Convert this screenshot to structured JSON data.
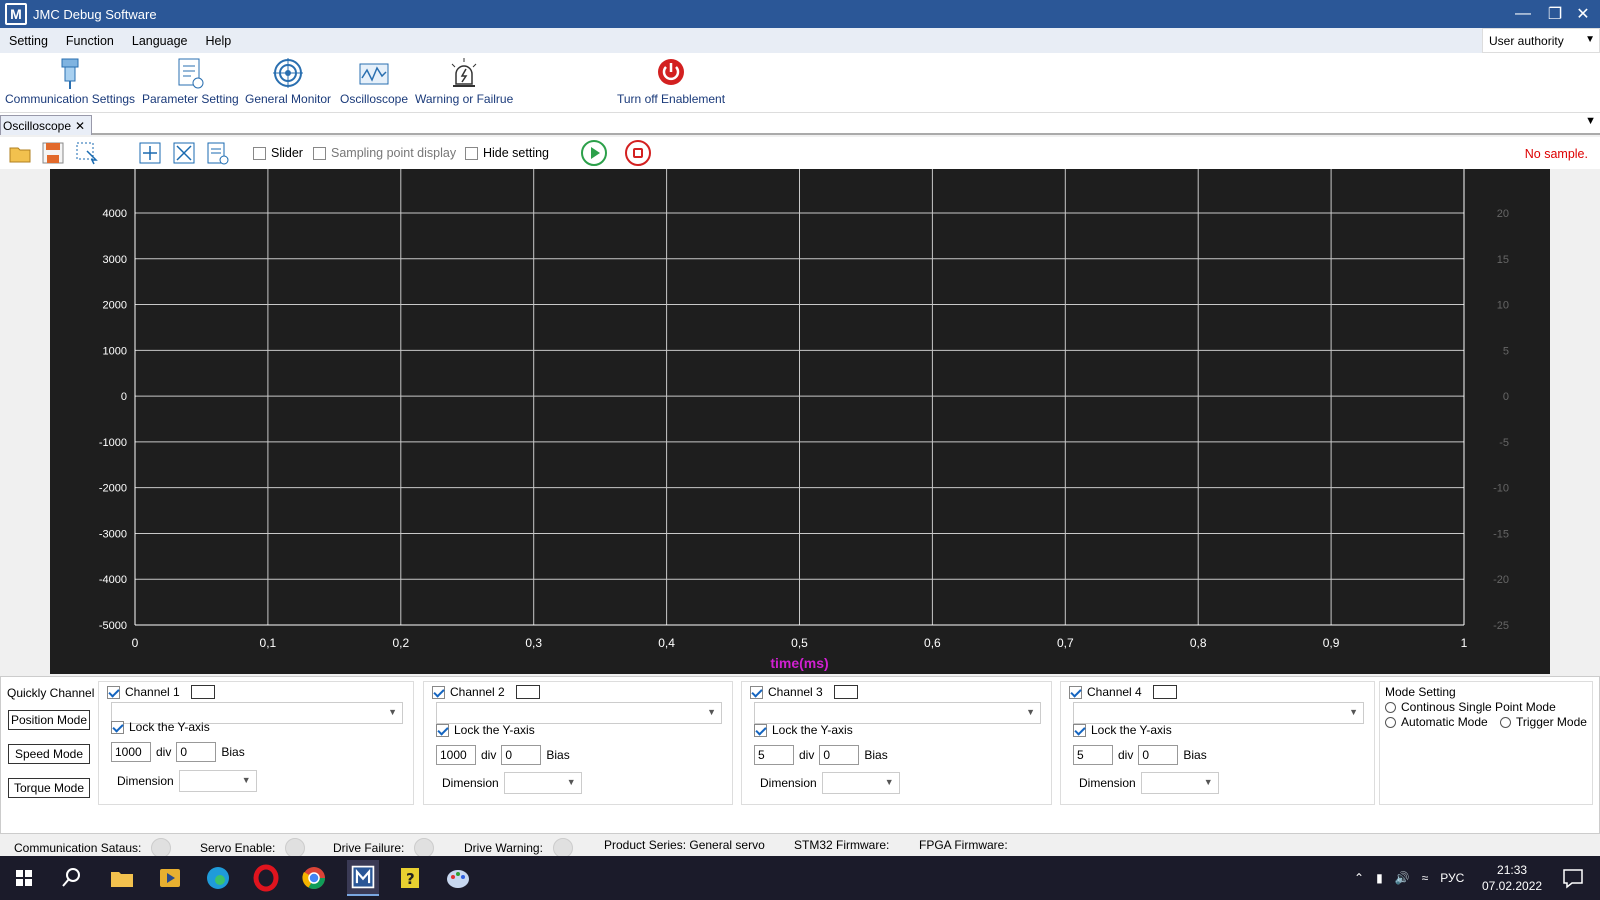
{
  "window": {
    "title": "JMC Debug Software",
    "logo_letter": "M"
  },
  "menu": {
    "items": [
      "Setting",
      "Function",
      "Language",
      "Help"
    ],
    "authority": "User authority"
  },
  "ribbon": {
    "comm": "Communication Settings",
    "param": "Parameter Setting",
    "monitor": "General Monitor",
    "osc": "Oscilloscope",
    "warn": "Warning or Failrue",
    "off": "Turn off Enablement"
  },
  "tab": {
    "label": "Oscilloscope"
  },
  "toolbar": {
    "slider": "Slider",
    "sampling": "Sampling point display",
    "hide": "Hide setting",
    "status": "No sample."
  },
  "chart_data": {
    "type": "line",
    "xlabel": "time(ms)",
    "xlim": [
      0,
      1
    ],
    "x_ticks": [
      "0",
      "0,1",
      "0,2",
      "0,3",
      "0,4",
      "0,5",
      "0,6",
      "0,7",
      "0,8",
      "0,9",
      "1"
    ],
    "y_left_ticks": [
      "4000",
      "3000",
      "2000",
      "1000",
      "0",
      "-1000",
      "-2000",
      "-3000",
      "-4000",
      "-5000"
    ],
    "y_right_ticks": [
      "20",
      "15",
      "10",
      "5",
      "0",
      "-5",
      "-10",
      "-15",
      "-20",
      "-25"
    ],
    "ylim_left": [
      -5000,
      5000
    ],
    "ylim_right": [
      -25,
      25
    ],
    "grid": true,
    "series": [],
    "colors": {
      "background": "#1e1e1e",
      "grid": "#c8c8c8",
      "xlabel": "#d020d0"
    }
  },
  "quick": {
    "label": "Quickly Channel",
    "position": "Position Mode",
    "speed": "Speed Mode",
    "torque": "Torque Mode"
  },
  "channels": [
    {
      "name": "Channel 1",
      "lock": "Lock the Y-axis",
      "div_value": "1000",
      "div": "div",
      "bias_value": "0",
      "bias": "Bias",
      "dimension": "Dimension"
    },
    {
      "name": "Channel 2",
      "lock": "Lock the Y-axis",
      "div_value": "1000",
      "div": "div",
      "bias_value": "0",
      "bias": "Bias",
      "dimension": "Dimension"
    },
    {
      "name": "Channel 3",
      "lock": "Lock the Y-axis",
      "div_value": "5",
      "div": "div",
      "bias_value": "0",
      "bias": "Bias",
      "dimension": "Dimension"
    },
    {
      "name": "Channel 4",
      "lock": "Lock the Y-axis",
      "div_value": "5",
      "div": "div",
      "bias_value": "0",
      "bias": "Bias",
      "dimension": "Dimension"
    }
  ],
  "mode": {
    "title": "Mode Setting",
    "continuous": "Continous Single Point Mode",
    "automatic": "Automatic Mode",
    "trigger": "Trigger Mode"
  },
  "status": {
    "comm": "Communication Sataus:",
    "servo": "Servo Enable:",
    "failure": "Drive Failure:",
    "warning": "Drive Warning:",
    "product": "Product Series: General servo",
    "stm32": "STM32 Firmware:",
    "fpga": "FPGA Firmware:"
  },
  "taskbar": {
    "lang": "РУС",
    "time": "21:33",
    "date": "07.02.2022"
  }
}
